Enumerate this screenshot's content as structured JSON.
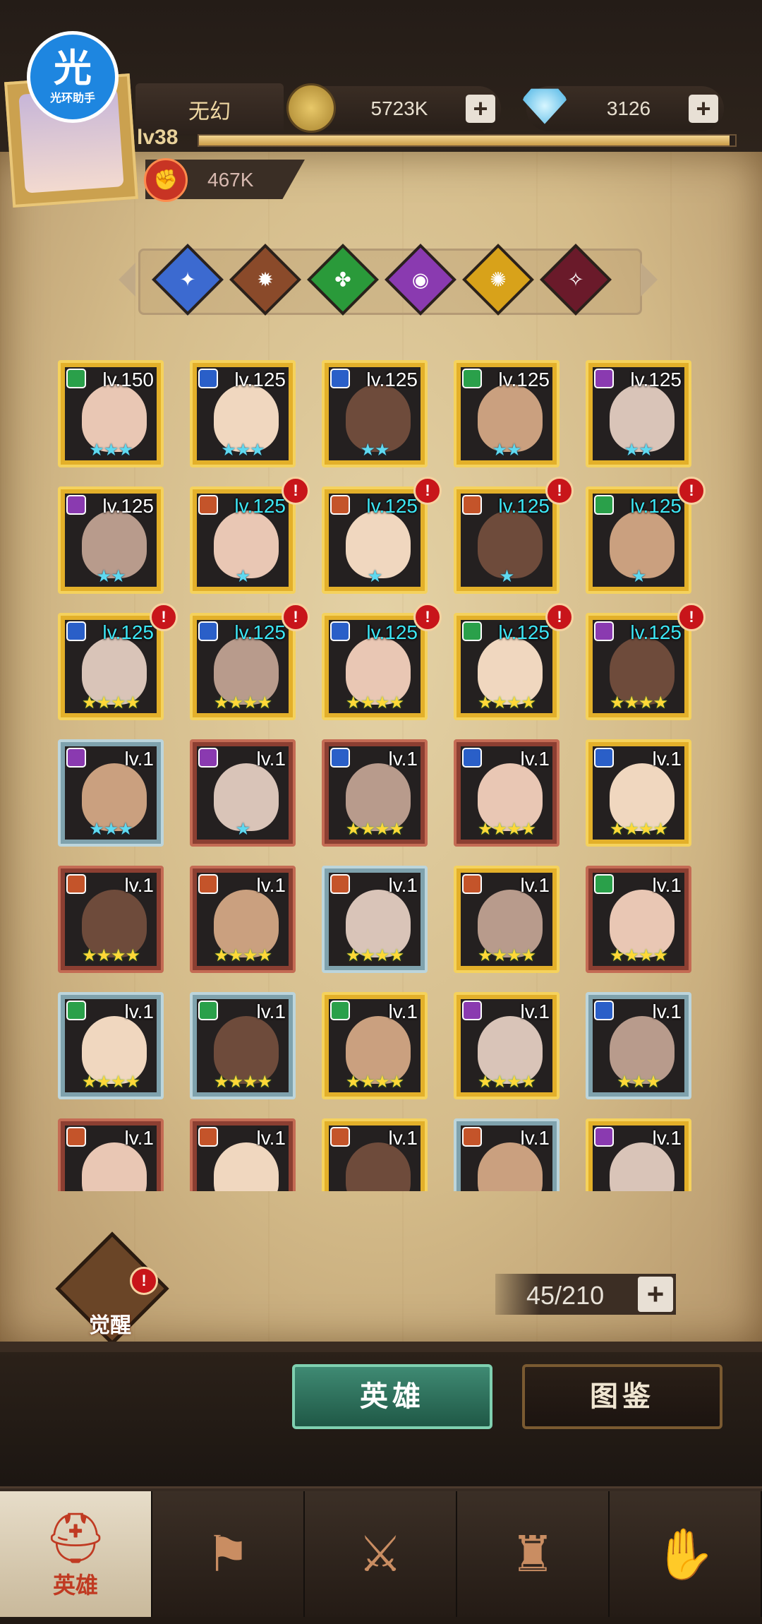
{
  "watermark": {
    "glyph": "光",
    "label": "光环助手"
  },
  "player": {
    "name": "无幻",
    "level": "lv38",
    "power": "467K",
    "xp_fraction": 0.99
  },
  "resources": {
    "gold": {
      "value": "5723K",
      "icon": "gold-coin-icon"
    },
    "diamond": {
      "value": "3126",
      "icon": "diamond-icon"
    }
  },
  "factions": [
    {
      "name": "faction-1",
      "color": "#3c6ad0",
      "glyph": "✦"
    },
    {
      "name": "faction-2",
      "color": "#8a4a2a",
      "glyph": "✹"
    },
    {
      "name": "faction-3",
      "color": "#2a9a3a",
      "glyph": "✤"
    },
    {
      "name": "faction-4",
      "color": "#8a3ab0",
      "glyph": "◉"
    },
    {
      "name": "faction-5",
      "color": "#d8a21a",
      "glyph": "✺"
    },
    {
      "name": "faction-6",
      "color": "#6a1a2a",
      "glyph": "✧"
    }
  ],
  "heroes": [
    {
      "level": "lv.150",
      "stars": "★★★",
      "star_color": "cyan",
      "frame": "gold",
      "cls_color": "#2aa04a",
      "lv_color": "white",
      "alert": false
    },
    {
      "level": "lv.125",
      "stars": "★★★",
      "star_color": "cyan",
      "frame": "gold",
      "cls_color": "#2a5fc8",
      "lv_color": "white",
      "alert": false
    },
    {
      "level": "lv.125",
      "stars": "★★",
      "star_color": "cyan",
      "frame": "gold",
      "cls_color": "#2a5fc8",
      "lv_color": "white",
      "alert": false
    },
    {
      "level": "lv.125",
      "stars": "★★",
      "star_color": "cyan",
      "frame": "gold",
      "cls_color": "#2aa04a",
      "lv_color": "white",
      "alert": false
    },
    {
      "level": "lv.125",
      "stars": "★★",
      "star_color": "cyan",
      "frame": "gold",
      "cls_color": "#8a3ab0",
      "lv_color": "white",
      "alert": false
    },
    {
      "level": "lv.125",
      "stars": "★★",
      "star_color": "cyan",
      "frame": "gold",
      "cls_color": "#8a3ab0",
      "lv_color": "white",
      "alert": false
    },
    {
      "level": "lv.125",
      "stars": "★",
      "star_color": "cyan",
      "frame": "gold",
      "cls_color": "#c4542a",
      "lv_color": "cyan",
      "alert": true
    },
    {
      "level": "lv.125",
      "stars": "★",
      "star_color": "cyan",
      "frame": "gold",
      "cls_color": "#c4542a",
      "lv_color": "cyan",
      "alert": true
    },
    {
      "level": "lv.125",
      "stars": "★",
      "star_color": "cyan",
      "frame": "gold",
      "cls_color": "#c4542a",
      "lv_color": "cyan",
      "alert": true
    },
    {
      "level": "lv.125",
      "stars": "★",
      "star_color": "cyan",
      "frame": "gold",
      "cls_color": "#2aa04a",
      "lv_color": "cyan",
      "alert": true
    },
    {
      "level": "lv.125",
      "stars": "★★★★",
      "star_color": "gold",
      "frame": "gold",
      "cls_color": "#2a5fc8",
      "lv_color": "cyan",
      "alert": true
    },
    {
      "level": "lv.125",
      "stars": "★★★★",
      "star_color": "gold",
      "frame": "gold",
      "cls_color": "#2a5fc8",
      "lv_color": "cyan",
      "alert": true
    },
    {
      "level": "lv.125",
      "stars": "★★★★",
      "star_color": "gold",
      "frame": "gold",
      "cls_color": "#2a5fc8",
      "lv_color": "cyan",
      "alert": true
    },
    {
      "level": "lv.125",
      "stars": "★★★★",
      "star_color": "gold",
      "frame": "gold",
      "cls_color": "#2aa04a",
      "lv_color": "cyan",
      "alert": true
    },
    {
      "level": "lv.125",
      "stars": "★★★★",
      "star_color": "gold",
      "frame": "gold",
      "cls_color": "#8a3ab0",
      "lv_color": "cyan",
      "alert": true
    },
    {
      "level": "lv.1",
      "stars": "★★★",
      "star_color": "cyan",
      "frame": "blue",
      "cls_color": "#8a3ab0",
      "lv_color": "white",
      "alert": false
    },
    {
      "level": "lv.1",
      "stars": "★",
      "star_color": "cyan",
      "frame": "red",
      "cls_color": "#8a3ab0",
      "lv_color": "white",
      "alert": false
    },
    {
      "level": "lv.1",
      "stars": "★★★★",
      "star_color": "gold",
      "frame": "red",
      "cls_color": "#2a5fc8",
      "lv_color": "white",
      "alert": false
    },
    {
      "level": "lv.1",
      "stars": "★★★★",
      "star_color": "gold",
      "frame": "red",
      "cls_color": "#2a5fc8",
      "lv_color": "white",
      "alert": false
    },
    {
      "level": "lv.1",
      "stars": "★★★★",
      "star_color": "gold",
      "frame": "gold",
      "cls_color": "#2a5fc8",
      "lv_color": "white",
      "alert": false
    },
    {
      "level": "lv.1",
      "stars": "★★★★",
      "star_color": "gold",
      "frame": "red",
      "cls_color": "#c4542a",
      "lv_color": "white",
      "alert": false
    },
    {
      "level": "lv.1",
      "stars": "★★★★",
      "star_color": "gold",
      "frame": "red",
      "cls_color": "#c4542a",
      "lv_color": "white",
      "alert": false
    },
    {
      "level": "lv.1",
      "stars": "★★★★",
      "star_color": "gold",
      "frame": "blue",
      "cls_color": "#c4542a",
      "lv_color": "white",
      "alert": false
    },
    {
      "level": "lv.1",
      "stars": "★★★★",
      "star_color": "gold",
      "frame": "gold",
      "cls_color": "#c4542a",
      "lv_color": "white",
      "alert": false
    },
    {
      "level": "lv.1",
      "stars": "★★★★",
      "star_color": "gold",
      "frame": "red",
      "cls_color": "#2aa04a",
      "lv_color": "white",
      "alert": false
    },
    {
      "level": "lv.1",
      "stars": "★★★★",
      "star_color": "gold",
      "frame": "blue",
      "cls_color": "#2aa04a",
      "lv_color": "white",
      "alert": false
    },
    {
      "level": "lv.1",
      "stars": "★★★★",
      "star_color": "gold",
      "frame": "blue",
      "cls_color": "#2aa04a",
      "lv_color": "white",
      "alert": false
    },
    {
      "level": "lv.1",
      "stars": "★★★★",
      "star_color": "gold",
      "frame": "gold",
      "cls_color": "#2aa04a",
      "lv_color": "white",
      "alert": false
    },
    {
      "level": "lv.1",
      "stars": "★★★★",
      "star_color": "gold",
      "frame": "gold",
      "cls_color": "#8a3ab0",
      "lv_color": "white",
      "alert": false
    },
    {
      "level": "lv.1",
      "stars": "★★★",
      "star_color": "gold",
      "frame": "blue",
      "cls_color": "#2a5fc8",
      "lv_color": "white",
      "alert": false
    },
    {
      "level": "lv.1",
      "stars": "",
      "star_color": "gold",
      "frame": "red",
      "cls_color": "#c4542a",
      "lv_color": "white",
      "alert": false
    },
    {
      "level": "lv.1",
      "stars": "",
      "star_color": "gold",
      "frame": "red",
      "cls_color": "#c4542a",
      "lv_color": "white",
      "alert": false
    },
    {
      "level": "lv.1",
      "stars": "",
      "star_color": "gold",
      "frame": "gold",
      "cls_color": "#c4542a",
      "lv_color": "white",
      "alert": false
    },
    {
      "level": "lv.1",
      "stars": "",
      "star_color": "gold",
      "frame": "blue",
      "cls_color": "#c4542a",
      "lv_color": "white",
      "alert": false
    },
    {
      "level": "lv.1",
      "stars": "",
      "star_color": "gold",
      "frame": "gold",
      "cls_color": "#8a3ab0",
      "lv_color": "white",
      "alert": false
    }
  ],
  "awaken": {
    "label": "觉醒",
    "alert": "!"
  },
  "hero_count": "45/210",
  "alert_glyph": "!",
  "plus_glyph": "+",
  "tabs": {
    "heroes": "英雄",
    "codex": "图鉴"
  },
  "nav": [
    {
      "label": "英雄",
      "icon": "helmet-icon",
      "glyph": "⛑"
    },
    {
      "label": "",
      "icon": "flag-icon",
      "glyph": "⚑"
    },
    {
      "label": "",
      "icon": "crossed-swords-icon",
      "glyph": "⚔"
    },
    {
      "label": "",
      "icon": "castle-icon",
      "glyph": "♜"
    },
    {
      "label": "",
      "icon": "handshake-emblem-icon",
      "glyph": "✋"
    }
  ]
}
